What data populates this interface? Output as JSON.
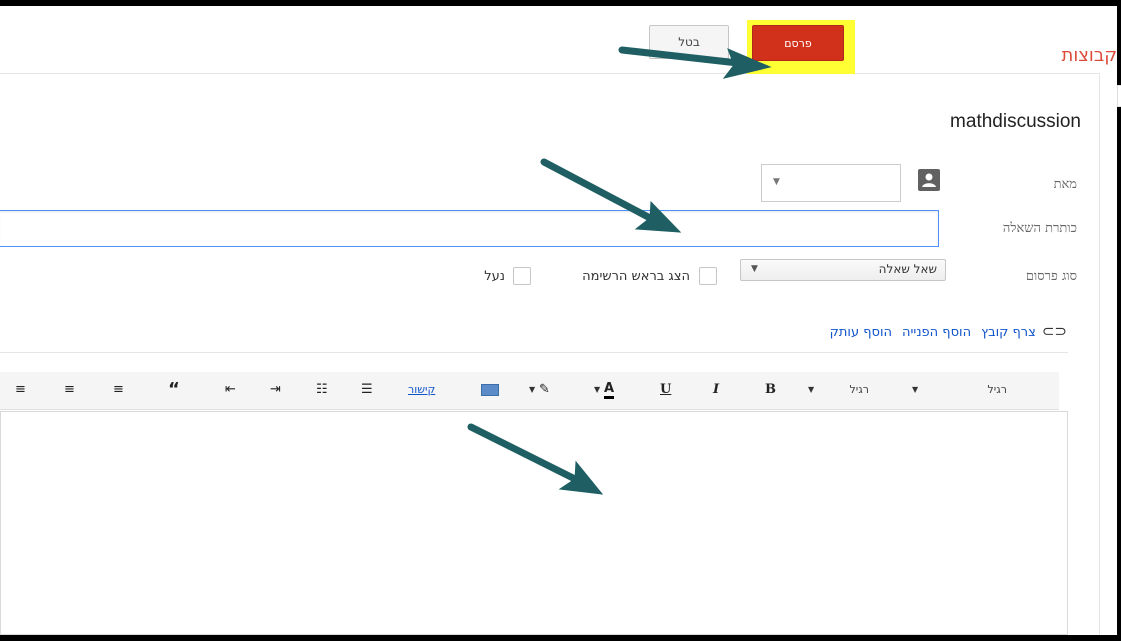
{
  "header": {
    "title": "קבוצות",
    "publish_label": "פרסם",
    "cancel_label": "בטל"
  },
  "form": {
    "group_name": "mathdiscussion",
    "from_label": "מאת",
    "subject_label": "כותרת השאלה",
    "subject_value": "",
    "type_label": "סוג פרסום",
    "type_value": "שאל שאלה",
    "pin_label": "הצג בראש הרשימה",
    "lock_label": "נעל",
    "pin_checked": false,
    "lock_checked": false
  },
  "attachments": {
    "attach_file": "צרף קובץ",
    "add_reference": "הוסף הפנייה",
    "add_copy": "הוסף עותק"
  },
  "toolbar": {
    "font_value": "רגיל",
    "size_value": "רגיל",
    "bold": "B",
    "italic": "I",
    "underline": "U",
    "text_color": "A",
    "link": "קישור"
  },
  "colors": {
    "publish_bg": "#d1311b",
    "highlight": "#ffff33",
    "arrow": "#1f5f63",
    "title_red": "#dd4b39"
  },
  "icons": [
    "avatar-icon",
    "paperclip-icon",
    "highlighter-icon",
    "image-icon",
    "blockquote-icon"
  ]
}
